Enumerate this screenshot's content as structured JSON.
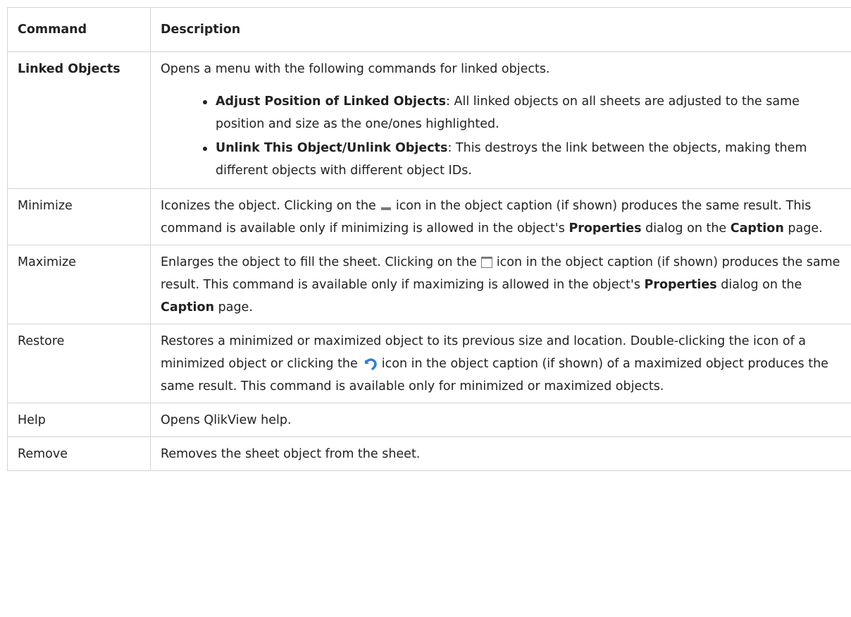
{
  "table": {
    "header_command": "Command",
    "header_description": "Description",
    "rows": {
      "linked": {
        "command": "Linked Objects",
        "description": "Opens a menu with the following commands for linked objects.",
        "bullets": [
          {
            "title": "Adjust Position of Linked Objects",
            "text": ": All linked objects on all sheets are adjusted to the same position and size as the one/ones highlighted."
          },
          {
            "title": "Unlink This Object/Unlink Objects",
            "text": ": This destroys the link between the objects, making them different objects with different object IDs."
          }
        ]
      },
      "minimize": {
        "command": "Minimize",
        "d1": "Iconizes the object. Clicking on the",
        "d2": "icon in the object caption (if shown) produces the same result. This command is available only if minimizing is allowed in the object's",
        "b1": "Properties",
        "d3": "dialog on the",
        "b2": "Caption",
        "d4": "page.",
        "icon": "minimize-icon"
      },
      "maximize": {
        "command": "Maximize",
        "d1": "Enlarges the object to fill the sheet. Clicking on the",
        "d2": "icon in the object caption (if shown) produces the same result. This command is available only if maximizing is allowed in the object's",
        "b1": "Properties",
        "d3": "dialog on the",
        "b2": "Caption",
        "d4": "page.",
        "icon": "maximize-icon"
      },
      "restore": {
        "command": "Restore",
        "d1": "Restores a minimized or maximized object to its previous size and location. Double-clicking the icon of a minimized object or clicking the",
        "d2": "icon in the object caption (if shown) of a maximized object produces the same result. This command is available only for minimized or maximized objects.",
        "icon": "restore-icon"
      },
      "help": {
        "command": "Help",
        "description": "Opens QlikView help."
      },
      "remove": {
        "command": "Remove",
        "description": "Removes the sheet object from the sheet."
      }
    }
  },
  "colors": {
    "border": "#d4d4d4",
    "text": "#222222",
    "icon_gray": "#7a7a7a",
    "restore_blue": "#2f7fd8"
  }
}
